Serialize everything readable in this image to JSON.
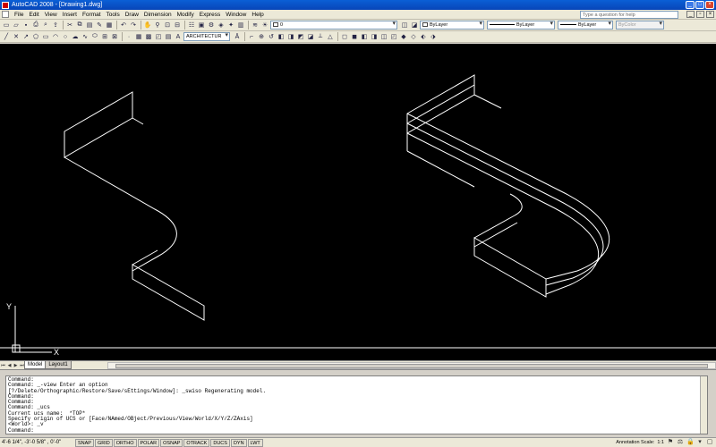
{
  "window": {
    "title": "AutoCAD 2008 - [Drawing1.dwg]",
    "minimize_glyph": "_",
    "maximize_glyph": "□",
    "close_glyph": "×"
  },
  "menubar": {
    "items": [
      "File",
      "Edit",
      "View",
      "Insert",
      "Format",
      "Tools",
      "Draw",
      "Dimension",
      "Modify",
      "Express",
      "Window",
      "Help"
    ],
    "help_placeholder": "Type a question for help",
    "doc_minimize": "_",
    "doc_restore": "▫",
    "doc_close": "×"
  },
  "toolbar1": {
    "layer_value": "0",
    "color_value": "ByLayer",
    "linetype_value": "ByLayer",
    "lineweight_value": "ByLayer",
    "plotstyle_value": "ByColor"
  },
  "toolbar2": {
    "textstyle_value": "ARCHITECTUR"
  },
  "canvas": {
    "ucs_x_label": "X",
    "ucs_y_label": "Y",
    "background": "#000000",
    "linework_color": "#ffffff"
  },
  "layout_tabs": {
    "tabs": [
      "Model",
      "Layout1"
    ],
    "active": "Model"
  },
  "command_history": [
    "Command:",
    "Command: _-view Enter an option",
    "[?/Delete/Orthographic/Restore/Save/sEttings/Window]: _swiso Regenerating model.",
    "Command:",
    "Command:",
    "Command: _ucs",
    "Current ucs name:  *TOP*",
    "Specify origin of UCS or [Face/NAmed/OBject/Previous/View/World/X/Y/Z/ZAxis]",
    "<World>: _v",
    "Command:"
  ],
  "statusbar": {
    "coordinates": "4'-6 1/4\",  -3'-0 5/8\" , 0'-0\"",
    "toggles": [
      "SNAP",
      "GRID",
      "ORTHO",
      "POLAR",
      "OSNAP",
      "OTRACK",
      "DUCS",
      "DYN",
      "LWT"
    ],
    "annotation_scale_label": "Annotation Scale:",
    "annotation_scale_value": "1:1"
  }
}
